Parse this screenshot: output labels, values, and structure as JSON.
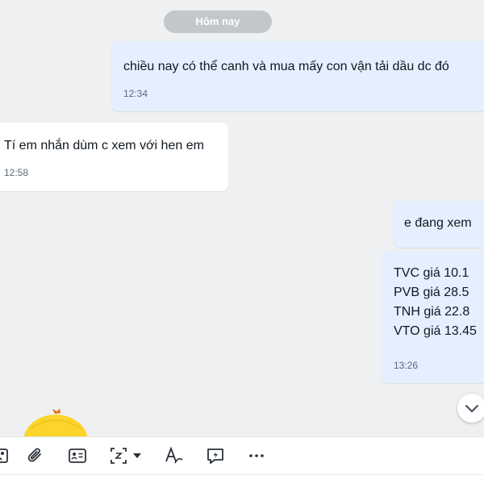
{
  "colors": {
    "chat_background": "#eef0f1",
    "sent_bubble": "#e5efff",
    "received_bubble": "#ffffff",
    "divider_pill": "#c3c7cc",
    "timestamp": "#5a6a7e"
  },
  "divider": {
    "label": "Hôm nay"
  },
  "messages": [
    {
      "direction": "sent",
      "text": "chiều nay có thể canh và mua mấy con vận tải dầu dc đó",
      "time": "12:34"
    },
    {
      "direction": "received",
      "text": "Tí em nhắn dùm c xem với hen em",
      "time": "12:58"
    },
    {
      "direction": "sent",
      "text": "e đang xem"
    },
    {
      "direction": "sent",
      "lines": [
        "TVC giá 10.1",
        "PVB giá 28.5",
        "TNH giá 22.8",
        "VTO giá 13.45"
      ],
      "time": "13:26"
    }
  ],
  "toolbar": {
    "icons": [
      "image-icon",
      "paperclip-icon",
      "contact-card-icon",
      "screenshot-icon",
      "dropdown-caret-icon",
      "text-format-icon",
      "quick-message-icon",
      "more-icon"
    ]
  },
  "scroll_button": {
    "icon": "chevron-down-icon"
  },
  "sticker": {
    "icon": "chick-sticker"
  }
}
